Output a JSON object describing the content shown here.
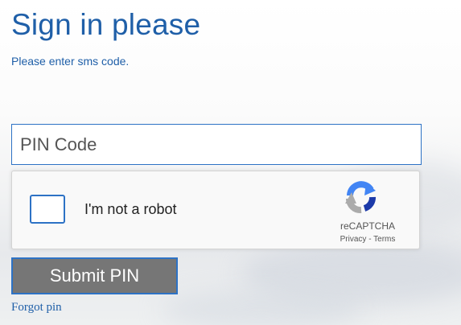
{
  "page": {
    "title": "Sign in please",
    "subtitle": "Please enter sms code."
  },
  "form": {
    "pin_input": {
      "value": "",
      "placeholder": "PIN Code"
    },
    "submit_label": "Submit PIN",
    "forgot_label": "Forgot pin"
  },
  "recaptcha": {
    "checkbox_label": "I'm not a robot",
    "checked": false,
    "brand": "reCAPTCHA",
    "privacy_label": "Privacy",
    "separator": "-",
    "terms_label": "Terms",
    "logo_icon": "recaptcha-logo-icon"
  },
  "colors": {
    "heading_blue": "#1f5fa8",
    "border_blue": "#2d72c5",
    "button_gray": "#767676"
  }
}
